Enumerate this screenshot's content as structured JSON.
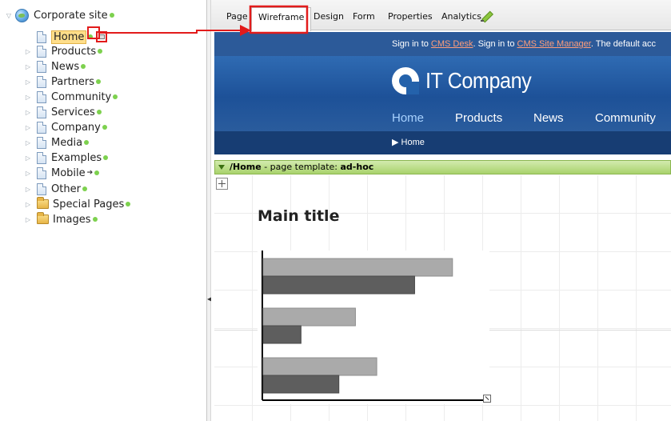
{
  "tree": {
    "root": {
      "label": "Corporate site",
      "icon": "globe-icon",
      "status_color": "#7dd14e"
    },
    "items": [
      {
        "label": "Home",
        "icon": "page-icon",
        "expander": false,
        "selected": true
      },
      {
        "label": "Products",
        "icon": "page-icon",
        "expander": true
      },
      {
        "label": "News",
        "icon": "page-icon",
        "expander": true
      },
      {
        "label": "Partners",
        "icon": "page-icon",
        "expander": true
      },
      {
        "label": "Community",
        "icon": "page-icon",
        "expander": true
      },
      {
        "label": "Services",
        "icon": "page-icon",
        "expander": true
      },
      {
        "label": "Company",
        "icon": "page-icon",
        "expander": true
      },
      {
        "label": "Media",
        "icon": "page-icon",
        "expander": true
      },
      {
        "label": "Examples",
        "icon": "page-icon",
        "expander": true
      },
      {
        "label": "Mobile",
        "icon": "page-icon",
        "expander": true,
        "mobile_arrow": "➔"
      },
      {
        "label": "Other",
        "icon": "page-icon",
        "expander": true
      },
      {
        "label": "Special Pages",
        "icon": "folder-icon",
        "expander": true
      },
      {
        "label": "Images",
        "icon": "folder-icon",
        "expander": true
      }
    ]
  },
  "tabs": [
    {
      "label": "Page",
      "active": false
    },
    {
      "label": "Wireframe",
      "active": true
    },
    {
      "label": "Design",
      "active": false
    },
    {
      "label": "Form",
      "active": false
    },
    {
      "label": "Properties",
      "active": false
    },
    {
      "label": "Analytics",
      "active": false
    }
  ],
  "preview": {
    "signin": {
      "pre": "Sign in to ",
      "link1": "CMS Desk",
      "mid": ". Sign in to ",
      "link2": "CMS Site Manager",
      "post": ". The default acc"
    },
    "logo_text": "IT Company",
    "nav": [
      "Home",
      "Products",
      "News",
      "Community"
    ],
    "breadcrumb": "▶ Home"
  },
  "template_bar": {
    "path": "/Home",
    "text": " - page template: ",
    "template_name": "ad-hoc"
  },
  "wireframe": {
    "title": "Main title"
  },
  "chart_data": {
    "type": "bar",
    "orientation": "horizontal",
    "series": [
      {
        "values": [
          0.8,
          0.39,
          0.48
        ]
      },
      {
        "values": [
          0.64,
          0.16,
          0.32
        ]
      }
    ],
    "categories": [
      "",
      "",
      ""
    ],
    "series_colors": [
      "#aaaaaa",
      "#5e5e5e"
    ]
  },
  "colors": {
    "site_blue": "#2c5a99",
    "nav_dark": "#173d73",
    "template_green": "#a8d26c",
    "annotation_red": "#e21b1b"
  }
}
